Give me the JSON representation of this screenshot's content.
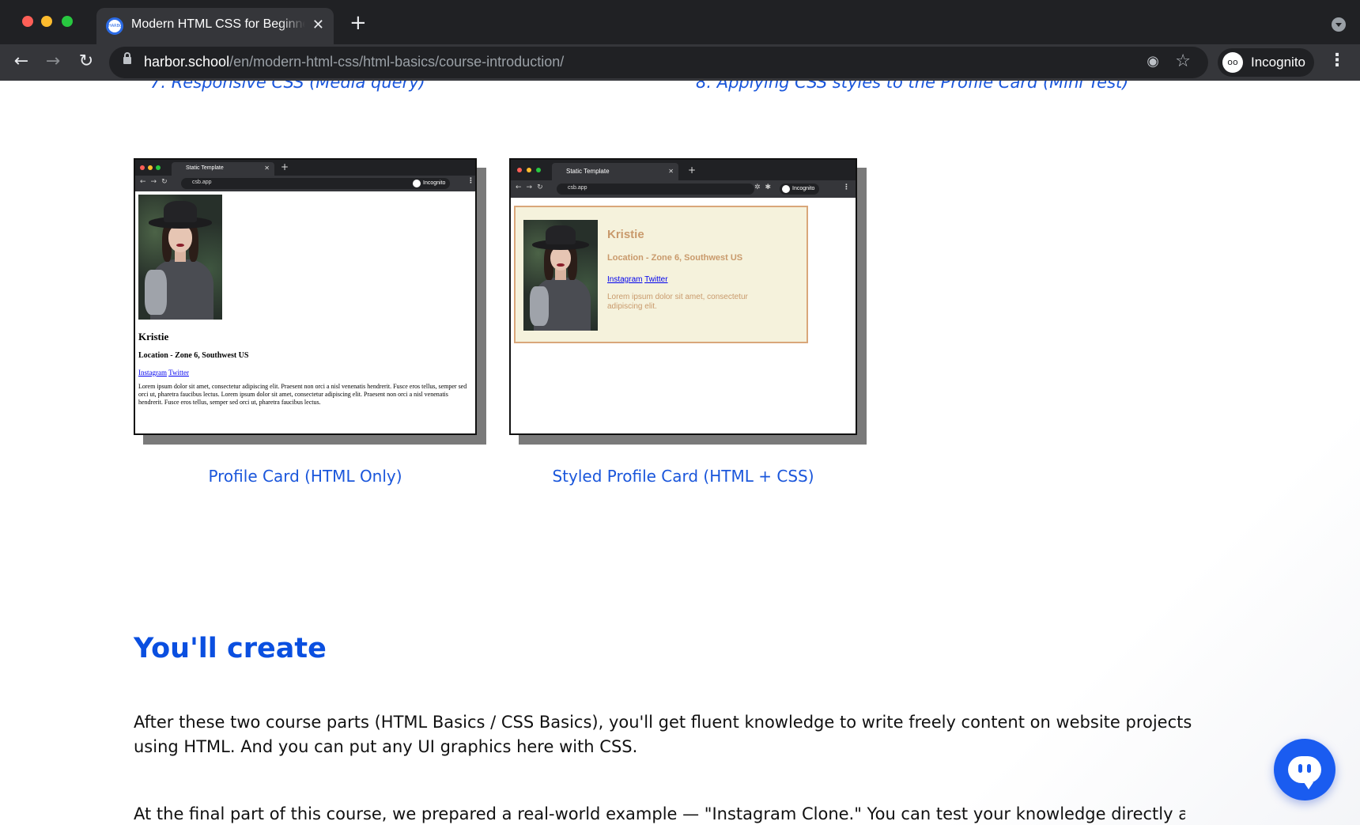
{
  "browser": {
    "tab_title": "Modern HTML CSS for Beginners",
    "tab_favicon_text": "HARBOR SCHOOL",
    "tab_close": "✕",
    "new_tab": "+",
    "url_host": "harbor.school",
    "url_path": "/en/modern-html-css/html-basics/course-introduction/",
    "profile_label": "Incognito",
    "icons": [
      "back-icon",
      "forward-icon",
      "reload-icon",
      "lock-icon",
      "eye-off-icon",
      "star-icon",
      "incognito-icon",
      "kebab-menu-icon",
      "tab-search-icon"
    ]
  },
  "toc": {
    "item7": "7. Responsive CSS (Media query)",
    "item8": "8. Applying CSS styles to the Profile Card (Mini Test)"
  },
  "cards": [
    {
      "caption": "Profile Card (HTML Only)",
      "mini_tab_title": "Static Template",
      "mini_url": "csb.app",
      "mini_profile": "Incognito",
      "name": "Kristie",
      "location": "Location - Zone 6, Southwest US",
      "link1": "Instagram",
      "link2": "Twitter",
      "lorem": "Lorem ipsum dolor sit amet, consectetur adipiscing elit. Praesent non orci a nisl venenatis hendrerit. Fusce eros tellus, semper sed orci ut, pharetra faucibus lectus. Lorem ipsum dolor sit amet, consectetur adipiscing elit. Praesent non orci a nisl venenatis hendrerit. Fusce eros tellus, semper sed orci ut, pharetra faucibus lectus."
    },
    {
      "caption": "Styled Profile Card (HTML + CSS)",
      "mini_tab_title": "Static Template",
      "mini_url": "csb.app",
      "mini_profile": "Incognito",
      "name": "Kristie",
      "location": "Location - Zone 6, Southwest US",
      "link1": "Instagram",
      "link2": "Twitter",
      "lorem": "Lorem ipsum dolor sit amet, consectetur adipiscing elit."
    }
  ],
  "section": {
    "title": "You'll create",
    "para1": "After these two course parts (HTML Basics / CSS Basics), you'll get fluent knowledge to write freely content on website projects using HTML. And you can put any UI graphics here with CSS.",
    "para2": "At the final part of this course, we prepared a real-world example — \"Instagram Clone.\" You can test your knowledge directly and"
  },
  "colors": {
    "accent": "#1a56db",
    "title": "#0a4fe0",
    "chat": "#1a5cf0",
    "styled_card_bg": "#f5f2dc",
    "styled_card_text": "#c99a6c"
  }
}
